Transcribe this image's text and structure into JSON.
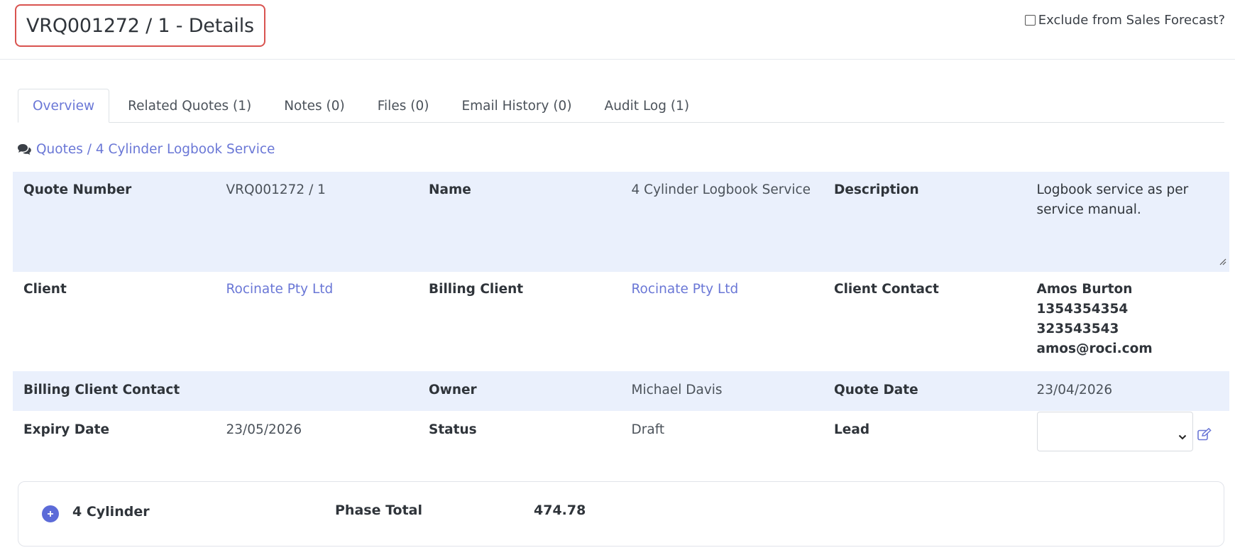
{
  "header": {
    "title": "VRQ001272 / 1 - Details",
    "exclude_forecast_label": "Exclude from Sales Forecast?",
    "exclude_forecast_checked": false
  },
  "tabs": [
    {
      "label": "Overview",
      "active": true
    },
    {
      "label": "Related Quotes (1)",
      "active": false
    },
    {
      "label": "Notes (0)",
      "active": false
    },
    {
      "label": "Files (0)",
      "active": false
    },
    {
      "label": "Email History (0)",
      "active": false
    },
    {
      "label": "Audit Log (1)",
      "active": false
    }
  ],
  "breadcrumb": {
    "icon": "comments-icon",
    "text": "Quotes / 4 Cylinder Logbook Service"
  },
  "details": {
    "quote_number": {
      "label": "Quote Number",
      "value": "VRQ001272 / 1"
    },
    "name": {
      "label": "Name",
      "value": "4 Cylinder Logbook Service"
    },
    "description": {
      "label": "Description",
      "value_line1": "Logbook service as per",
      "value_line2": "service manual."
    },
    "client": {
      "label": "Client",
      "value": "Rocinate Pty Ltd"
    },
    "billing_client": {
      "label": "Billing Client",
      "value": "Rocinate Pty Ltd"
    },
    "client_contact": {
      "label": "Client Contact",
      "name": "Amos Burton",
      "phone1": "1354354354",
      "phone2": "323543543",
      "email": "amos@roci.com"
    },
    "billing_client_contact": {
      "label": "Billing Client Contact",
      "value": ""
    },
    "owner": {
      "label": "Owner",
      "value": "Michael Davis"
    },
    "quote_date": {
      "label": "Quote Date",
      "value": "23/04/2026"
    },
    "expiry_date": {
      "label": "Expiry Date",
      "value": "23/05/2026"
    },
    "status": {
      "label": "Status",
      "value": "Draft"
    },
    "lead": {
      "label": "Lead",
      "selected": ""
    }
  },
  "phase": {
    "name": "4 Cylinder",
    "total_label": "Phase Total",
    "total_value": "474.78"
  },
  "colors": {
    "accent": "#6a77d6",
    "title_highlight": "#d9534f",
    "row_shade": "#eaf0fc"
  }
}
